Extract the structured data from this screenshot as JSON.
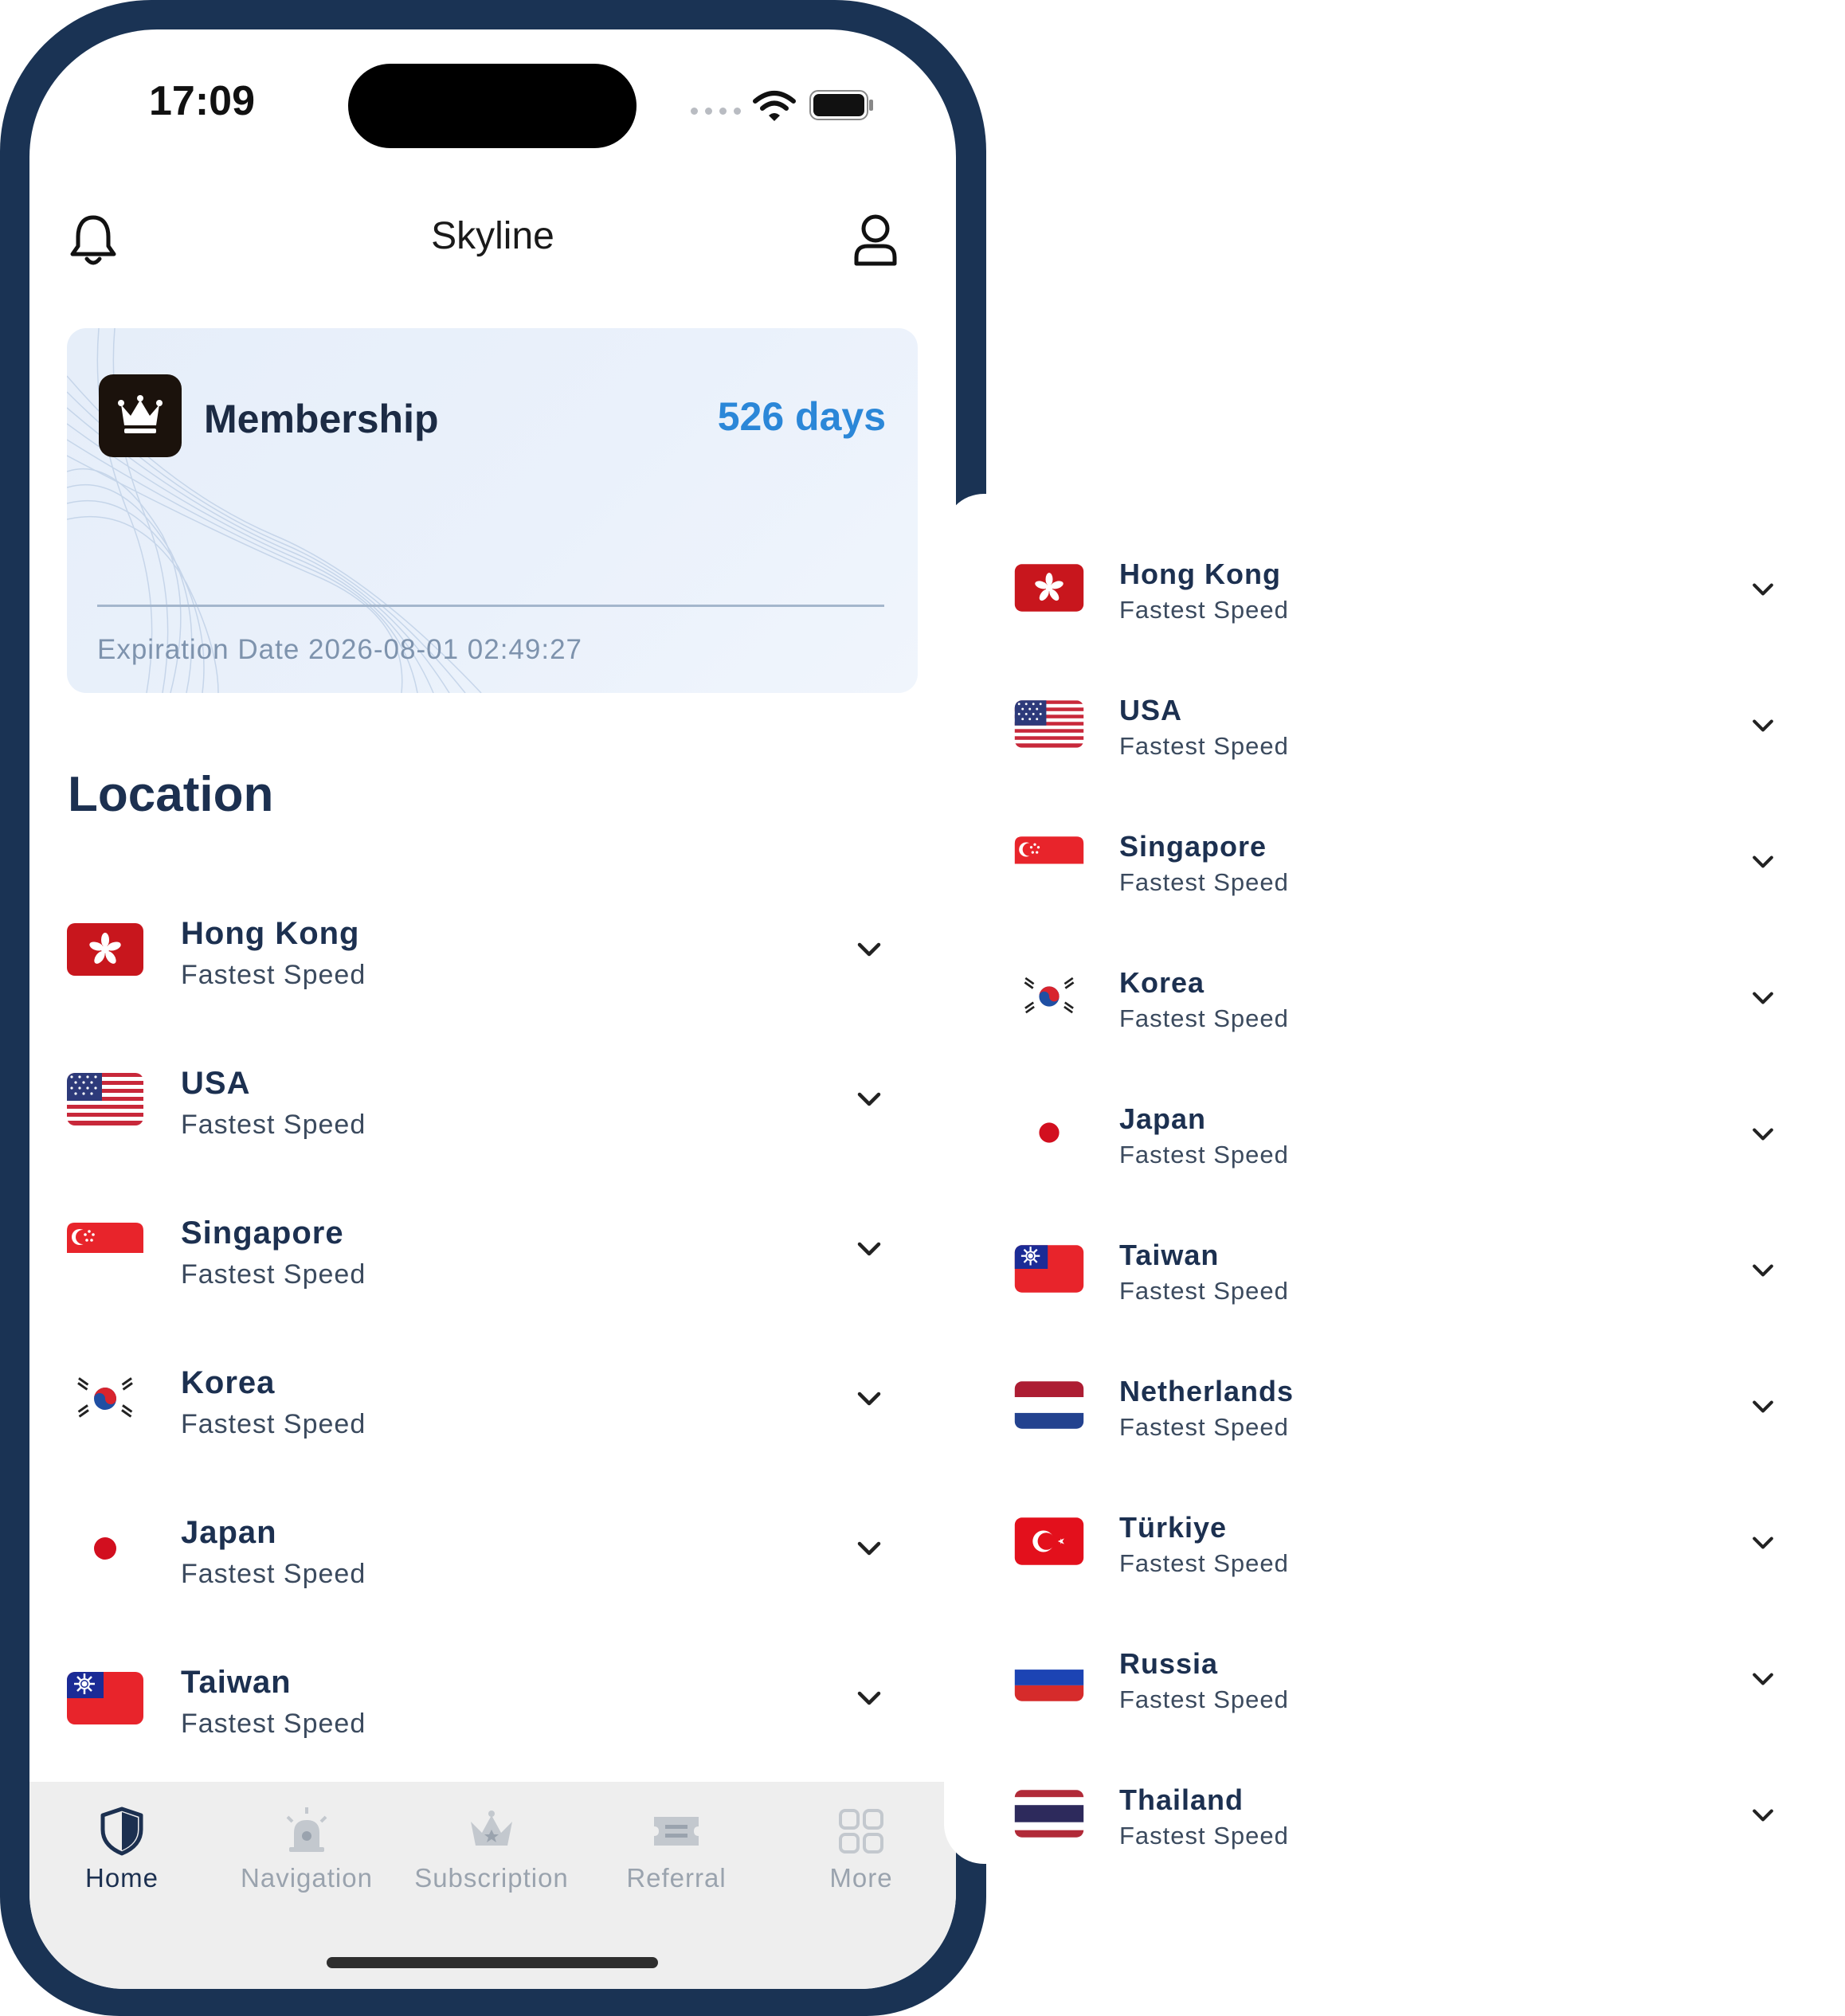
{
  "status_bar": {
    "time": "17:09"
  },
  "header": {
    "title": "Skyline"
  },
  "membership": {
    "label": "Membership",
    "days": "526 days",
    "expiration": "Expiration Date 2026-08-01 02:49:27"
  },
  "location": {
    "title": "Location",
    "items": [
      {
        "name": "Hong Kong",
        "sub": "Fastest Speed",
        "flag": "hk-flag-icon"
      },
      {
        "name": "USA",
        "sub": "Fastest Speed",
        "flag": "us-flag-icon"
      },
      {
        "name": "Singapore",
        "sub": "Fastest Speed",
        "flag": "sg-flag-icon"
      },
      {
        "name": "Korea",
        "sub": "Fastest Speed",
        "flag": "kr-flag-icon"
      },
      {
        "name": "Japan",
        "sub": "Fastest Speed",
        "flag": "jp-flag-icon"
      },
      {
        "name": "Taiwan",
        "sub": "Fastest Speed",
        "flag": "tw-flag-icon"
      }
    ]
  },
  "tabs": [
    {
      "label": "Home",
      "icon": "shield-icon",
      "active": true
    },
    {
      "label": "Navigation",
      "icon": "siren-icon",
      "active": false
    },
    {
      "label": "Subscription",
      "icon": "crown-icon",
      "active": false
    },
    {
      "label": "Referral",
      "icon": "ticket-icon",
      "active": false
    },
    {
      "label": "More",
      "icon": "grid-icon",
      "active": false
    }
  ],
  "extended_list": {
    "items": [
      {
        "name": "Hong Kong",
        "sub": "Fastest Speed",
        "flag": "hk-flag-icon"
      },
      {
        "name": "USA",
        "sub": "Fastest Speed",
        "flag": "us-flag-icon"
      },
      {
        "name": "Singapore",
        "sub": "Fastest Speed",
        "flag": "sg-flag-icon"
      },
      {
        "name": "Korea",
        "sub": "Fastest Speed",
        "flag": "kr-flag-icon"
      },
      {
        "name": "Japan",
        "sub": "Fastest Speed",
        "flag": "jp-flag-icon"
      },
      {
        "name": "Taiwan",
        "sub": "Fastest Speed",
        "flag": "tw-flag-icon"
      },
      {
        "name": "Netherlands",
        "sub": "Fastest Speed",
        "flag": "nl-flag-icon"
      },
      {
        "name": "Türkiye",
        "sub": "Fastest Speed",
        "flag": "tr-flag-icon"
      },
      {
        "name": "Russia",
        "sub": "Fastest Speed",
        "flag": "ru-flag-icon"
      },
      {
        "name": "Thailand",
        "sub": "Fastest Speed",
        "flag": "th-flag-icon"
      }
    ]
  },
  "colors": {
    "frame": "#1a3354",
    "accent": "#2b87d8",
    "text_dark": "#1c3050",
    "card_bg": "#e8f0fa"
  }
}
